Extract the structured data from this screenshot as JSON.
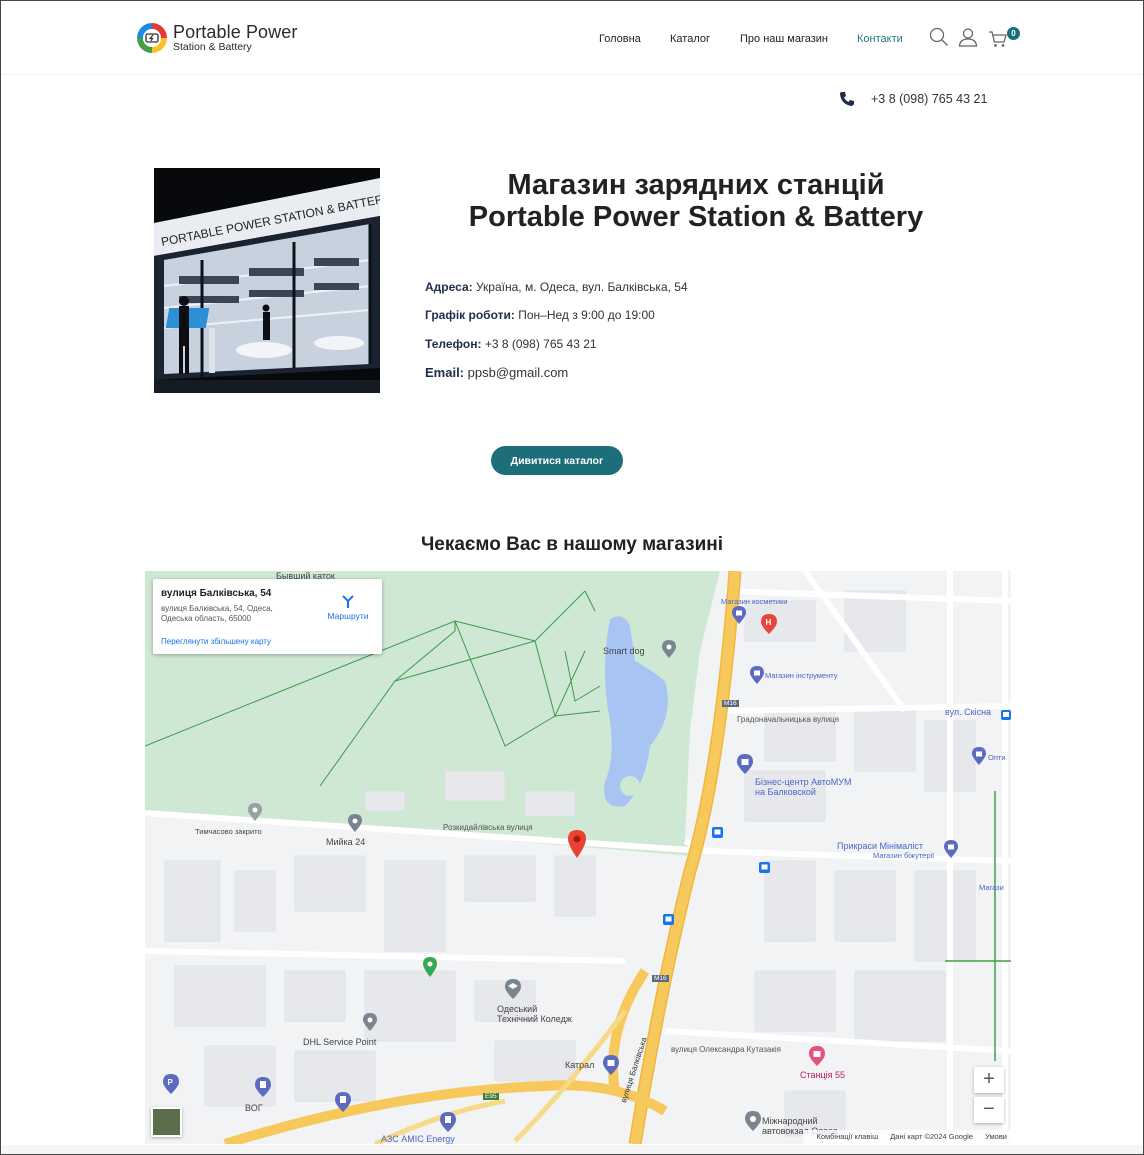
{
  "header": {
    "logo_title": "Portable Power",
    "logo_subtitle": "Station & Battery",
    "nav": [
      "Головна",
      "Каталог",
      "Про наш магазин",
      "Контакти"
    ],
    "active_nav": "Контакти",
    "cart_count": "0",
    "icons": [
      "search-icon",
      "user-icon",
      "cart-icon"
    ]
  },
  "top_phone": "+3 8 (098) 765 43 21",
  "store": {
    "image_sign": "PORTABLE POWER STATION & BATTERY",
    "title_line1": "Магазин зарядних станцій",
    "title_line2": "Portable Power Station & Battery",
    "info": [
      {
        "label": "Адреса:",
        "value": "Україна, м. Одеса, вул. Балківська, 54"
      },
      {
        "label": "Графік роботи:",
        "value": "Пон–Нед з 9:00 до 19:00"
      },
      {
        "label": "Телефон:",
        "value": "+3 8 (098) 765 43 21"
      },
      {
        "label": "Email:",
        "value": "ppsb@gmail.com"
      }
    ],
    "cta": "Дивитися каталог"
  },
  "map_section": {
    "title": "Чекаємо Вас в нашому магазині",
    "card": {
      "title": "вулиця Балківська, 54",
      "address": "вулиця Балківська, 54, Одеса, Одеська область, 65000",
      "directions": "Маршрути",
      "larger_map": "Переглянути збільшену карту"
    },
    "labels": {
      "skating": "Бывший каток",
      "smart_dog": "Smart dog",
      "cosmetics": "Магазин косметики",
      "tools": "Магазин інструменту",
      "skisna": "вул. Скісна",
      "business": "Бізнес-центр АвтоМУМ",
      "business2": "на Балковской",
      "temp_closed": "Тимчасово закрито",
      "wash": "Мийка 24",
      "rozkydailivska": "Розкидайлівська вулиця",
      "minimalist": "Прикраси Мінімаліст",
      "jewelry": "Магазин біжутерії",
      "college1": "Одеський",
      "college2": "Технічний Коледж",
      "dhl": "DHL Service Point",
      "katral": "Катрал",
      "kutuzakiya": "вулиця Олександра Кутазакія",
      "station55": "Станція 55",
      "vog": "ВОГ",
      "amic": "АЗС AMIC Energy",
      "airport1": "Міжнародний",
      "airport2": "автовокзал Одеса",
      "balkivska": "вулиця Балківська",
      "gradonach": "Градоначальницька вулиця",
      "m16": "M16",
      "e95": "E95",
      "opti": "Опти",
      "magaz": "Магази"
    },
    "attribution": {
      "shortcuts": "Комбінації клавіш",
      "data": "Дані карт ©2024 Google",
      "terms": "Умови"
    },
    "zoom_in": "+",
    "zoom_out": "−"
  },
  "colors": {
    "accent": "#1c6e7a",
    "nav_active": "#1c7a86",
    "park": "#cfe8d3",
    "water": "#a7c4f2",
    "highway": "#f7c95c",
    "label_blue": "#4a66c9",
    "pin_red": "#ea4335"
  }
}
